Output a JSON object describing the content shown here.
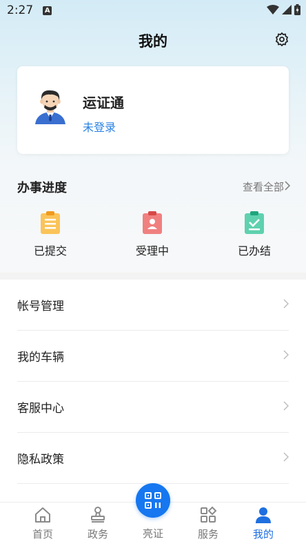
{
  "status_bar": {
    "time": "2:27",
    "notification_badge": "A"
  },
  "header": {
    "title": "我的",
    "settings_icon": "gear-icon"
  },
  "profile": {
    "app_name": "运证通",
    "login_status": "未登录",
    "avatar_icon": "user-avatar"
  },
  "progress": {
    "title": "办事进度",
    "view_all": "查看全部",
    "items": [
      {
        "label": "已提交",
        "icon": "submitted-doc-icon",
        "color": "#f7b739"
      },
      {
        "label": "受理中",
        "icon": "processing-doc-icon",
        "color": "#ec5f5f"
      },
      {
        "label": "已办结",
        "icon": "completed-doc-icon",
        "color": "#34c49a"
      }
    ]
  },
  "menu": [
    {
      "label": "帐号管理"
    },
    {
      "label": "我的车辆"
    },
    {
      "label": "客服中心"
    },
    {
      "label": "隐私政策"
    }
  ],
  "tabs": [
    {
      "label": "首页",
      "icon": "home-icon",
      "active": false
    },
    {
      "label": "政务",
      "icon": "stamp-icon",
      "active": false
    },
    {
      "label": "亮证",
      "icon": "qr-code-icon",
      "active": false
    },
    {
      "label": "服务",
      "icon": "grid-icon",
      "active": false
    },
    {
      "label": "我的",
      "icon": "person-icon",
      "active": true
    }
  ],
  "colors": {
    "accent": "#1677f0",
    "link": "#2a82e4",
    "active_tab": "#1e6fe0"
  }
}
